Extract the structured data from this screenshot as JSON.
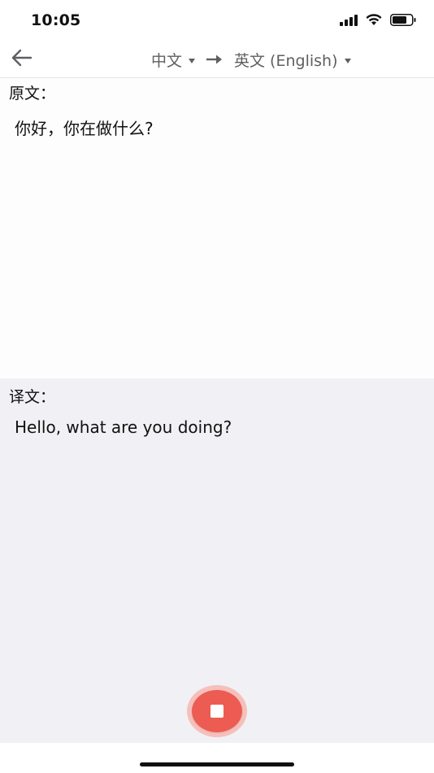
{
  "status_bar": {
    "time": "10:05",
    "icons": [
      "signal-icon",
      "wifi-icon",
      "battery-icon"
    ]
  },
  "header": {
    "back_icon": "arrow-left-icon",
    "source_language": "中文",
    "target_language": "英文 (English)",
    "direction_icon": "arrow-right-icon"
  },
  "source": {
    "label": "原文：",
    "text": "你好，你在做什么?"
  },
  "translation": {
    "label": "译文：",
    "text": "Hello, what are you doing?"
  },
  "controls": {
    "stop_icon": "stop-icon",
    "accent_color": "#ec5c52"
  }
}
